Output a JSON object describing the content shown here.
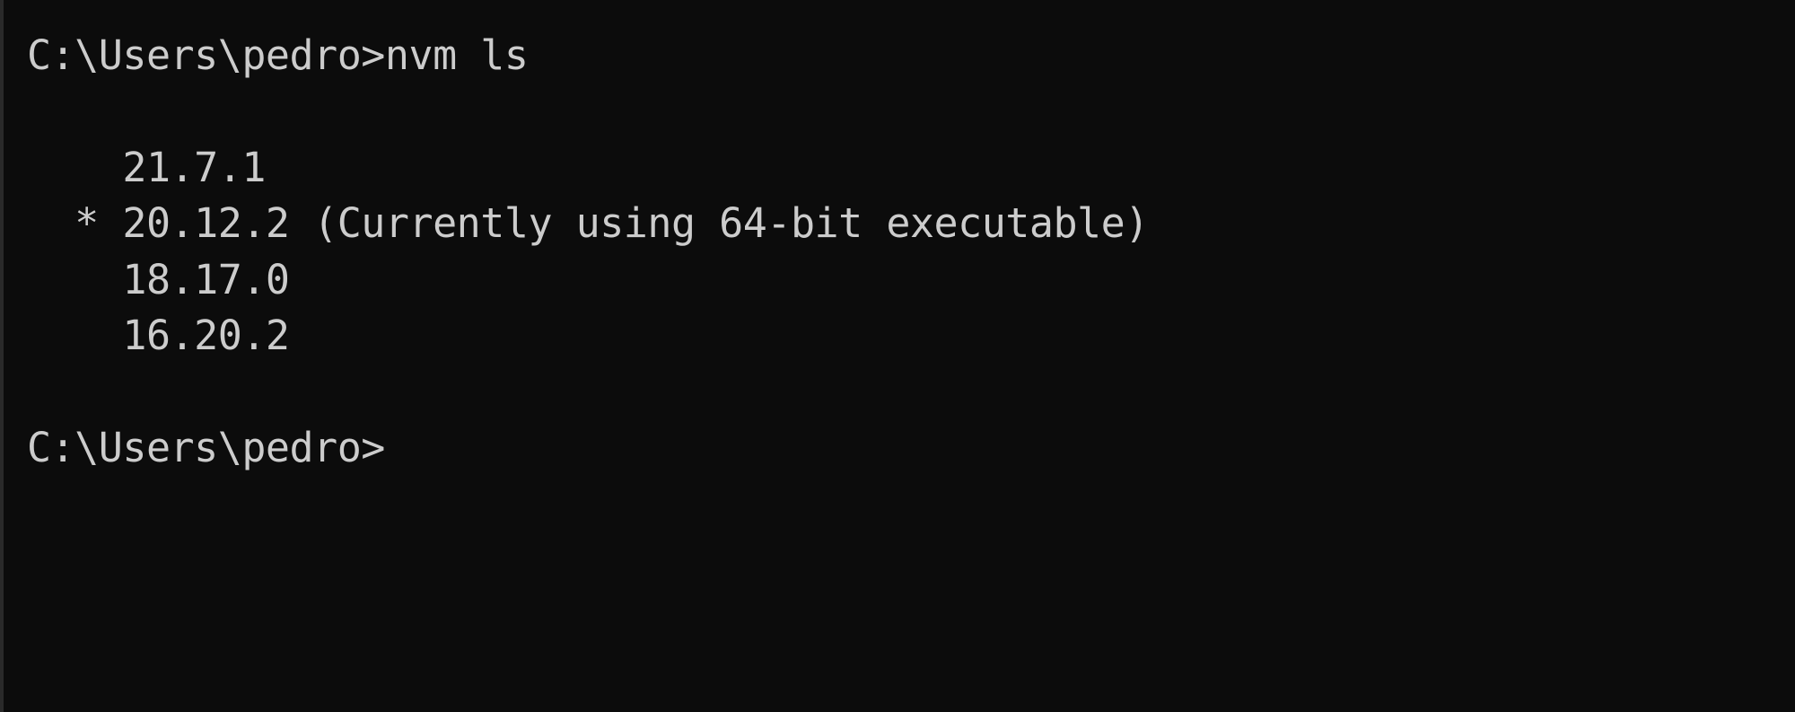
{
  "terminal": {
    "lines": {
      "command": "C:\\Users\\pedro>nvm ls",
      "version_1": "    21.7.1",
      "version_2": "  * 20.12.2 (Currently using 64-bit executable)",
      "version_3": "    18.17.0",
      "version_4": "    16.20.2",
      "prompt": "C:\\Users\\pedro>"
    },
    "colors": {
      "background": "#0c0c0c",
      "foreground": "#cccccc"
    }
  }
}
